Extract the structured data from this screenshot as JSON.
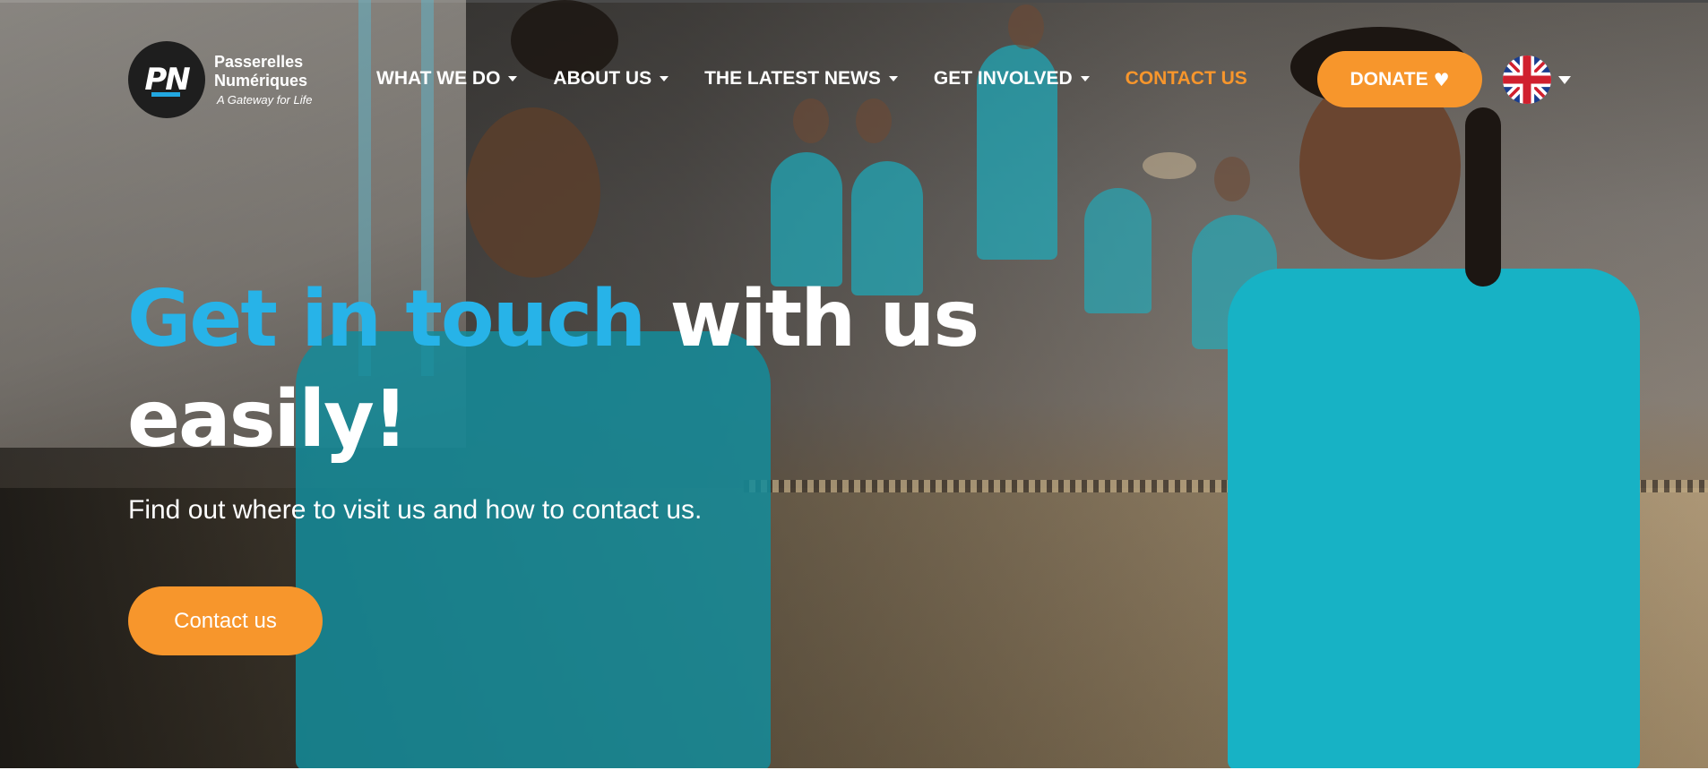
{
  "brand": {
    "mark": "PN",
    "name_line1": "Passerelles",
    "name_line2": "Numériques",
    "tagline": "A Gateway for Life"
  },
  "nav": {
    "items": [
      {
        "label": "WHAT WE DO",
        "has_dropdown": true
      },
      {
        "label": "ABOUT US",
        "has_dropdown": true
      },
      {
        "label": "THE LATEST NEWS",
        "has_dropdown": true
      },
      {
        "label": "GET INVOLVED",
        "has_dropdown": true
      },
      {
        "label": "CONTACT US",
        "has_dropdown": false,
        "active": true
      }
    ],
    "donate_label": "DONATE",
    "donate_icon": "heart-icon",
    "language_icon": "uk-flag-icon"
  },
  "hero": {
    "headline_accent": "Get in touch",
    "headline_rest": "with us",
    "headline_line2": "easily!",
    "subtitle": "Find out where to visit us and how to contact us.",
    "cta_label": "Contact us"
  },
  "colors": {
    "accent_orange": "#f7962c",
    "accent_blue": "#27b3e8",
    "shirt_teal": "#17b2c5"
  }
}
